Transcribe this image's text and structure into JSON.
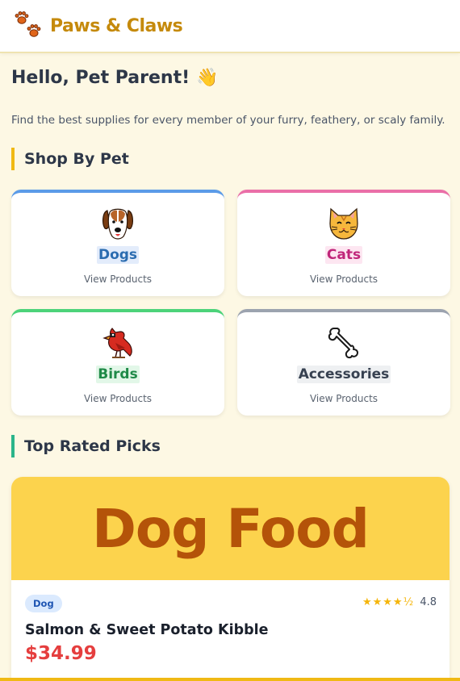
{
  "header": {
    "brand": "Paws & Claws",
    "logo_icon": "paw-prints-icon"
  },
  "greeting": {
    "title": "Hello, Pet Parent!",
    "emoji": "👋"
  },
  "intro": "Find the best supplies for every member of your furry, feathery, or scaly family.",
  "shop_by_pet": {
    "title": "Shop By Pet",
    "items": [
      {
        "name": "Dogs",
        "link": "View Products",
        "icon": "dog-face-icon",
        "accent": "#5b9be8",
        "text_color": "#2b6cb0",
        "chip_bg": "#e3ecfb"
      },
      {
        "name": "Cats",
        "link": "View Products",
        "icon": "cat-face-icon",
        "accent": "#ea6fa8",
        "text_color": "#c0267a",
        "chip_bg": "#fde6f1"
      },
      {
        "name": "Birds",
        "link": "View Products",
        "icon": "bird-icon",
        "accent": "#4cd37a",
        "text_color": "#1f8a48",
        "chip_bg": "#e2f7e8"
      },
      {
        "name": "Accessories",
        "link": "View Products",
        "icon": "bone-icon",
        "accent": "#9ca3af",
        "text_color": "#374151",
        "chip_bg": "#eef0f2"
      }
    ]
  },
  "top_rated": {
    "title": "Top Rated Picks",
    "products": [
      {
        "banner": "Dog Food",
        "badge": "Dog",
        "stars": "★★★★½",
        "rating": "4.8",
        "name": "Salmon & Sweet Potato Kibble",
        "price": "$34.99"
      }
    ]
  }
}
